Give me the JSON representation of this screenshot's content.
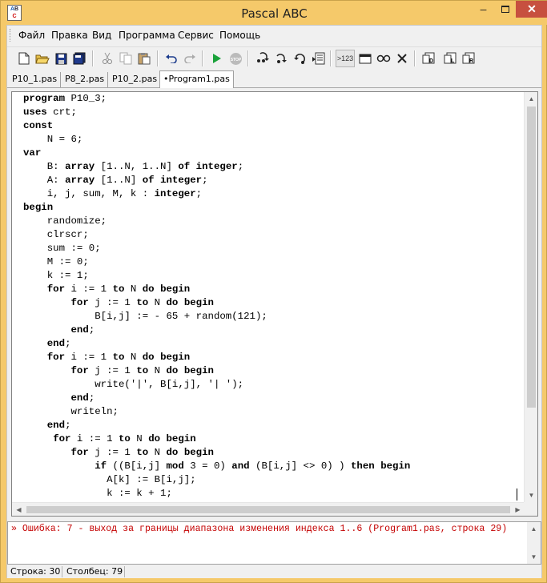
{
  "window": {
    "title": "Pascal ABC",
    "icon_text": [
      "ABC"
    ]
  },
  "menu": {
    "items": [
      {
        "id": "file",
        "label": "Файл"
      },
      {
        "id": "edit",
        "label": "Правка"
      },
      {
        "id": "view",
        "label": "Вид"
      },
      {
        "id": "program",
        "label": "Программа"
      },
      {
        "id": "service",
        "label": "Сервис"
      },
      {
        "id": "help",
        "label": "Помощь"
      }
    ]
  },
  "toolbar": {
    "icons": [
      "new-file-icon",
      "open-folder-icon",
      "save-icon",
      "save-all-icon",
      "cut-icon",
      "copy-icon",
      "paste-icon",
      "undo-icon",
      "redo-icon",
      "run-icon",
      "stop-icon",
      "step-into-icon",
      "step-over-icon",
      "step-out-icon",
      "run-to-cursor-icon",
      "watch-icon",
      "output-window-icon",
      "glasses-icon",
      "close-x-icon",
      "compile-icon",
      "debug-icon",
      "release-icon"
    ],
    "eval_label": ">123"
  },
  "tabs": [
    {
      "label": "P10_1.pas",
      "active": false
    },
    {
      "label": "P8_2.pas",
      "active": false
    },
    {
      "label": "P10_2.pas",
      "active": false
    },
    {
      "label": "•Program1.pas",
      "active": true
    }
  ],
  "editor": {
    "lines": [
      "program P10_3;",
      "uses crt;",
      "const",
      "    N = 6;",
      "var",
      "    B: array [1..N, 1..N] of integer;",
      "    A: array [1..N] of integer;",
      "    i, j, sum, M, k : integer;",
      "begin",
      "    randomize;",
      "    clrscr;",
      "    sum := 0;",
      "    M := 0;",
      "    k := 1;",
      "    for i := 1 to N do begin",
      "        for j := 1 to N do begin",
      "            B[i,j] := - 65 + random(121);",
      "        end;",
      "    end;",
      "    for i := 1 to N do begin",
      "        for j := 1 to N do begin",
      "            write('|', B[i,j], '| ');",
      "        end;",
      "        writeln;",
      "    end;",
      "     for i := 1 to N do begin",
      "        for j := 1 to N do begin",
      "            if ((B[i,j] mod 3 = 0) and (B[i,j] <> 0) ) then begin",
      "              A[k] := B[i,j];",
      "              k := k + 1;"
    ]
  },
  "output": {
    "error": "» Ошибка: 7 - выход за границы диапазона изменения индекса 1..6 (Program1.pas, строка 29)"
  },
  "status": {
    "row": "Строка: 30",
    "col": "Столбец: 79"
  }
}
